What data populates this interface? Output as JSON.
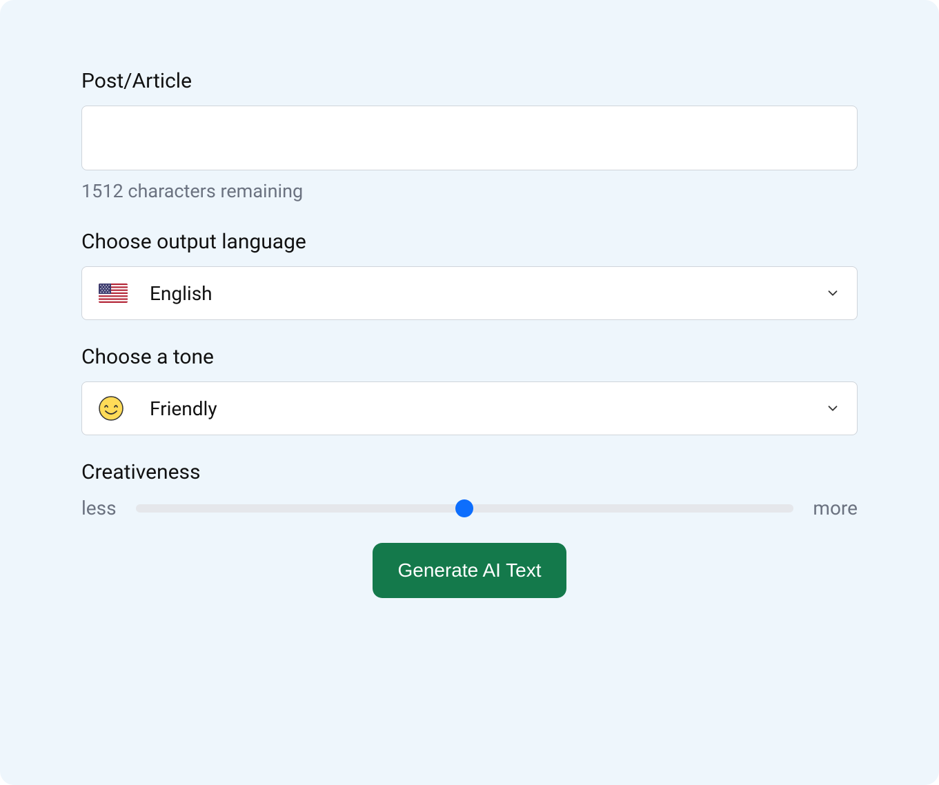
{
  "postArticle": {
    "label": "Post/Article",
    "value": "",
    "charRemaining": "1512 characters remaining"
  },
  "language": {
    "label": "Choose output language",
    "selected": "English",
    "flag": "us"
  },
  "tone": {
    "label": "Choose a tone",
    "selected": "Friendly",
    "emoji": "smile"
  },
  "creativeness": {
    "label": "Creativeness",
    "minLabel": "less",
    "maxLabel": "more",
    "valuePercent": 50
  },
  "generateButton": {
    "label": "Generate AI Text"
  }
}
